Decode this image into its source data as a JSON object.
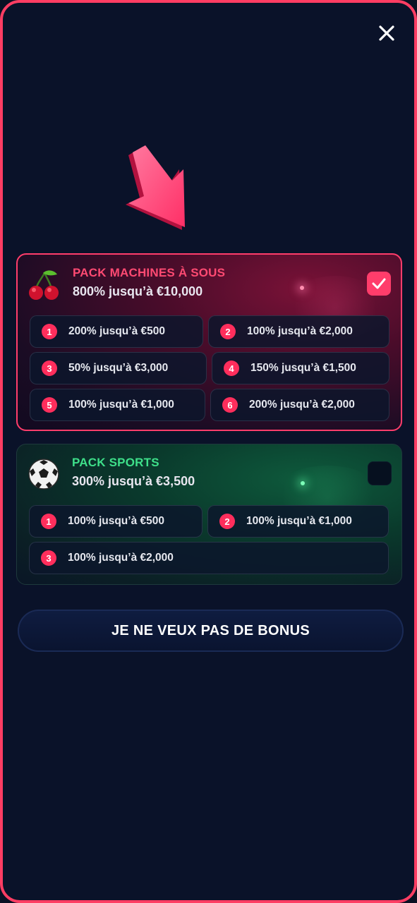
{
  "modal": {
    "close_icon": "close-icon",
    "accent_color": "#ff3d63"
  },
  "packs": [
    {
      "title": "PACK MACHINES À SOUS",
      "subtitle": "800% jusqu’à €10,000",
      "icon": "cherry-icon",
      "selected": true,
      "tiers": [
        {
          "num": "1",
          "label": "200% jusqu’à €500"
        },
        {
          "num": "2",
          "label": "100% jusqu’à €2,000"
        },
        {
          "num": "3",
          "label": "50% jusqu’à €3,000"
        },
        {
          "num": "4",
          "label": "150% jusqu’à €1,500"
        },
        {
          "num": "5",
          "label": "100% jusqu’à €1,000"
        },
        {
          "num": "6",
          "label": "200% jusqu’à €2,000"
        }
      ]
    },
    {
      "title": "PACK SPORTS",
      "subtitle": "300% jusqu’à €3,500",
      "icon": "soccer-ball-icon",
      "selected": false,
      "tiers": [
        {
          "num": "1",
          "label": "100% jusqu’à €500"
        },
        {
          "num": "2",
          "label": "100% jusqu’à €1,000"
        },
        {
          "num": "3",
          "label": "100% jusqu’à €2,000"
        }
      ]
    }
  ],
  "no_bonus_button": "JE NE VEUX PAS DE BONUS",
  "colors": {
    "slots_title": "#ff4a72",
    "sports_title": "#3ee08a",
    "badge": "#ff2e5c"
  }
}
